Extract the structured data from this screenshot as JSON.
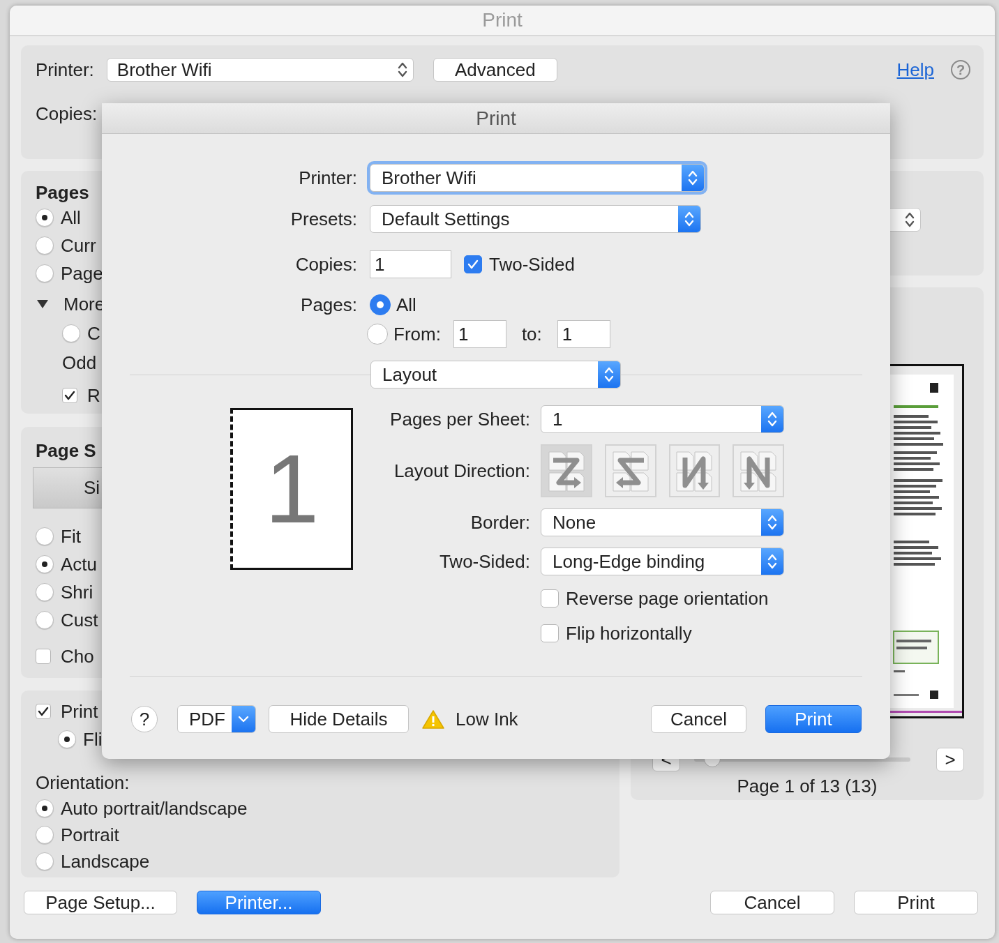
{
  "window": {
    "title": "Print"
  },
  "printer_row": {
    "label": "Printer:",
    "printer": "Brother Wifi",
    "advanced": "Advanced",
    "help": "Help",
    "help_button": "?"
  },
  "copies_label": "Copies:",
  "pages_panel": {
    "title": "Pages",
    "options": [
      {
        "label": "All",
        "selected": true
      },
      {
        "label": "Curr",
        "selected": false
      },
      {
        "label": "Page",
        "selected": false
      }
    ],
    "more": {
      "label": "More",
      "expanded": true
    },
    "more_options": [
      {
        "label": "C",
        "selected": false
      }
    ],
    "odd_label": "Odd",
    "reverse": {
      "label": "R",
      "checked": true
    }
  },
  "page_size_panel": {
    "title": "Page S",
    "tab": "Si",
    "options": [
      {
        "label": "Fit",
        "selected": false
      },
      {
        "label": "Actu",
        "selected": true
      },
      {
        "label": "Shri",
        "selected": false
      },
      {
        "label": "Cust",
        "selected": false
      }
    ],
    "choose": {
      "label": "Cho",
      "checked": false
    }
  },
  "print_panel": {
    "print": {
      "label": "Print",
      "checked": true
    },
    "sub_options": [
      {
        "label": "Fli",
        "selected": true
      }
    ],
    "orientation_label": "Orientation:",
    "orientation": [
      {
        "label": "Auto portrait/landscape",
        "selected": true
      },
      {
        "label": "Portrait",
        "selected": false
      },
      {
        "label": "Landscape",
        "selected": false
      }
    ]
  },
  "preview": {
    "prev": "<",
    "next": ">",
    "page_label": "Page 1 of 13 (13)"
  },
  "footer": [
    {
      "label": "Page Setup...",
      "kind": "normal"
    },
    {
      "label": "Printer...",
      "kind": "default"
    },
    {
      "label": "Cancel",
      "kind": "normal"
    },
    {
      "label": "Print",
      "kind": "normal"
    }
  ],
  "sheet": {
    "title": "Print",
    "printer_label": "Printer:",
    "printer": "Brother Wifi",
    "presets_label": "Presets:",
    "presets": "Default Settings",
    "copies_label": "Copies:",
    "copies": "1",
    "two_sided": {
      "label": "Two-Sided",
      "checked": true
    },
    "pages_label": "Pages:",
    "pages": [
      {
        "label": "All",
        "selected": true
      },
      {
        "label": "From:",
        "selected": false
      }
    ],
    "from": "1",
    "to_label": "to:",
    "to": "1",
    "section": "Layout",
    "preview_number": "1",
    "pages_per_sheet_label": "Pages per Sheet:",
    "pages_per_sheet": "1",
    "layout_direction_label": "Layout Direction:",
    "layout_directions": [
      {
        "selected": true
      },
      {
        "selected": false
      },
      {
        "selected": false
      },
      {
        "selected": false
      }
    ],
    "border_label": "Border:",
    "border": "None",
    "two_sided_label": "Two-Sided:",
    "two_sided_binding": "Long-Edge binding",
    "options": [
      {
        "label": "Reverse page orientation",
        "checked": false
      },
      {
        "label": "Flip horizontally",
        "checked": false
      }
    ],
    "footer": {
      "help": "?",
      "pdf": "PDF",
      "hide_details": "Hide Details",
      "status": "Low Ink",
      "cancel": "Cancel",
      "print": "Print"
    }
  }
}
